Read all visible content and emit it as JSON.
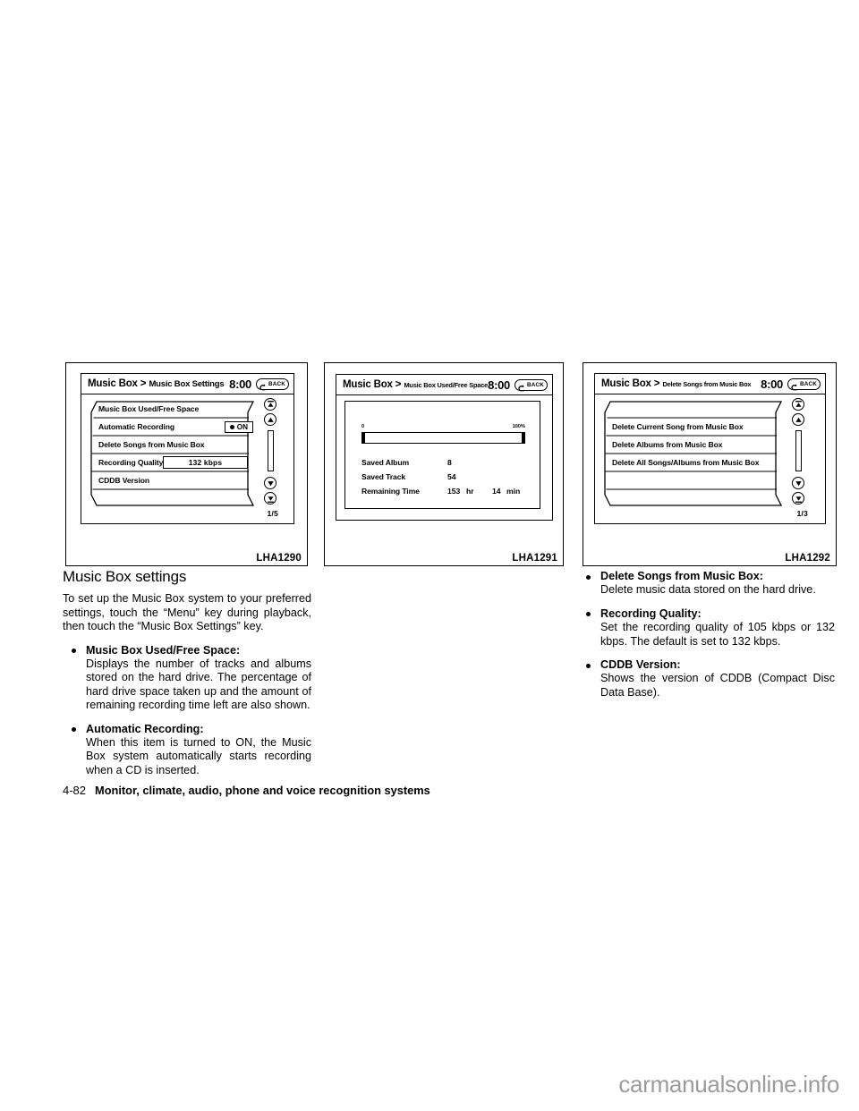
{
  "page": {
    "number": "4-82",
    "chapter_title": "Monitor, climate, audio, phone and voice recognition systems",
    "watermark": "carmanualsonline.info"
  },
  "figures": [
    {
      "code": "LHA1290",
      "screen": {
        "breadcrumb_root": "Music Box",
        "breadcrumb_sep": ">",
        "breadcrumb_leaf": "Music Box Settings",
        "clock": "8:00",
        "back_label": "BACK",
        "pager": "1/5",
        "rows": [
          {
            "label": "Music Box Used/Free Space"
          },
          {
            "label": "Automatic Recording",
            "toggle": "ON"
          },
          {
            "label": "Delete Songs from Music Box"
          },
          {
            "label": "Recording Quality",
            "value": "132 kbps"
          },
          {
            "label": "CDDB Version"
          },
          {
            "label": ""
          }
        ]
      }
    },
    {
      "code": "LHA1291",
      "screen": {
        "breadcrumb_root": "Music Box",
        "breadcrumb_sep": ">",
        "breadcrumb_leaf": "Music Box Used/Free Space",
        "clock": "8:00",
        "back_label": "BACK",
        "gauge": {
          "min_label": "0",
          "max_label": "100%",
          "fill_percent": 0
        },
        "stats": [
          {
            "label": "Saved Album",
            "value": "8",
            "unit": "",
            "value2": "",
            "unit2": ""
          },
          {
            "label": "Saved Track",
            "value": "54",
            "unit": "",
            "value2": "",
            "unit2": ""
          },
          {
            "label": "Remaining Time",
            "value": "153",
            "unit": "hr",
            "value2": "14",
            "unit2": "min"
          }
        ]
      }
    },
    {
      "code": "LHA1292",
      "screen": {
        "breadcrumb_root": "Music Box",
        "breadcrumb_sep": ">",
        "breadcrumb_leaf": "Delete Songs from Music Box",
        "clock": "8:00",
        "back_label": "BACK",
        "pager": "1/3",
        "rows": [
          {
            "label": ""
          },
          {
            "label": "Delete Current Song from Music Box"
          },
          {
            "label": "Delete Albums from Music Box"
          },
          {
            "label": "Delete All Songs/Albums from Music Box"
          },
          {
            "label": ""
          },
          {
            "label": ""
          }
        ]
      }
    }
  ],
  "body": {
    "heading": "Music Box settings",
    "intro": "To set up the Music Box system to your preferred settings, touch the “Menu” key during playback, then touch the “Music Box Settings” key.",
    "bullets_left": [
      {
        "title": "Music Box Used/Free Space:",
        "text": "Displays the number of tracks and albums stored on the hard drive. The percentage of hard drive space taken up and the amount of remaining recording time left are also shown."
      },
      {
        "title": "Automatic Recording:",
        "text": "When this item is turned to ON, the Music Box system automatically starts recording when a CD is inserted."
      }
    ],
    "bullets_right": [
      {
        "title": "Delete Songs from Music Box:",
        "text": "Delete music data stored on the hard drive."
      },
      {
        "title": "Recording Quality:",
        "text": "Set the recording quality of 105 kbps or 132 kbps. The default is set to 132 kbps."
      },
      {
        "title": "CDDB Version:",
        "text": "Shows the version of CDDB (Compact Disc Data Base)."
      }
    ]
  }
}
